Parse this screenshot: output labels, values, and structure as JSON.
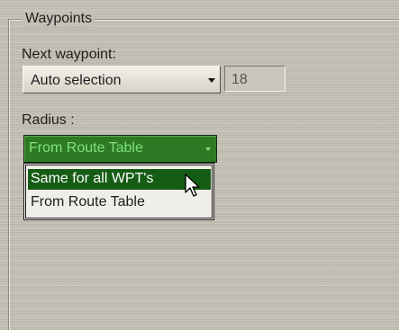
{
  "group": {
    "title": "Waypoints"
  },
  "next_waypoint": {
    "label": "Next waypoint:",
    "mode_selected": "Auto selection",
    "number_value": "18"
  },
  "radius": {
    "label": "Radius :",
    "selected": "From Route Table",
    "options": [
      {
        "label": "Same for all WPT's"
      },
      {
        "label": "From Route Table"
      }
    ]
  },
  "colors": {
    "panel_bg": "#c4c0b5",
    "dropdown_highlight": "#155c15",
    "green_combo_bg": "#2e7a24",
    "green_combo_text": "#7ee27c"
  },
  "icons": [
    "chevron-down-icon",
    "mouse-pointer-icon"
  ]
}
